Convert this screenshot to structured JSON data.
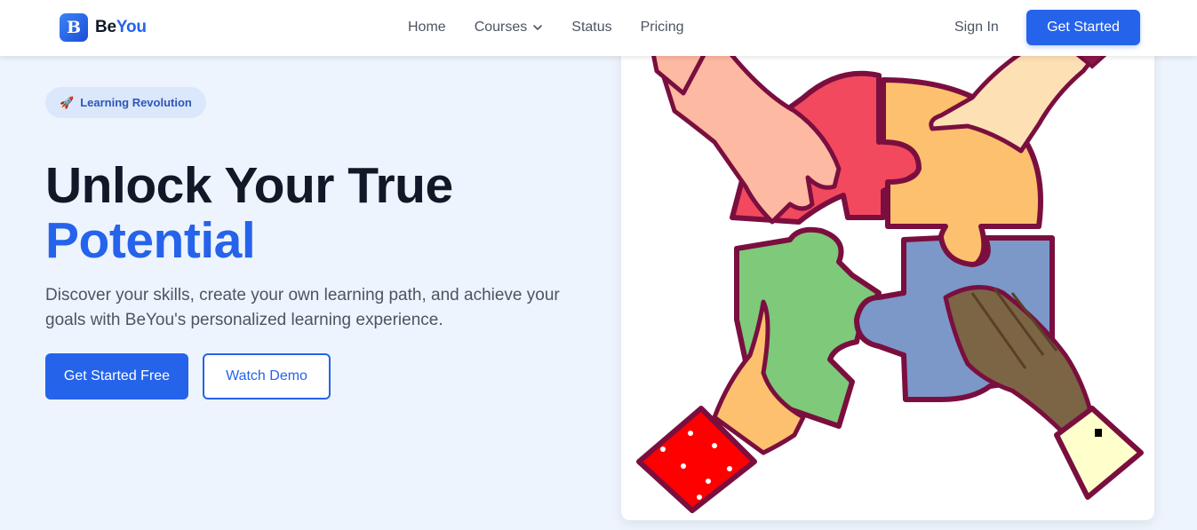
{
  "brand": {
    "mark": "B",
    "name_part1": "Be",
    "name_part2": "You"
  },
  "nav": {
    "links": [
      "Home",
      "Courses",
      "Status",
      "Pricing"
    ],
    "sign_in": "Sign In",
    "cta": "Get Started"
  },
  "hero": {
    "badge_icon": "rocket-icon",
    "badge": "Learning Revolution",
    "title_line1": "Unlock Your True",
    "title_line2": "Potential",
    "subtitle": "Discover your skills, create your own learning path, and achieve your goals with BeYou's personalized learning experience.",
    "primary_button": "Get Started Free",
    "secondary_button": "Watch Demo"
  },
  "colors": {
    "accent": "#2563eb",
    "background": "#eef4fd",
    "puzzle_red": "#f2495f",
    "puzzle_orange": "#fdc06e",
    "puzzle_green": "#7ec97a",
    "puzzle_blue": "#7b98c9",
    "outline": "#7a0f3f"
  }
}
